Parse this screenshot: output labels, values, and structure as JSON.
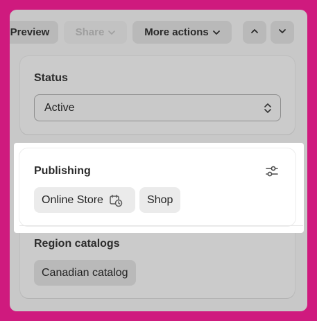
{
  "toolbar": {
    "preview_label": "Preview",
    "share_label": "Share",
    "more_actions_label": "More actions"
  },
  "status": {
    "title": "Status",
    "selected": "Active"
  },
  "publishing": {
    "title": "Publishing",
    "channels": [
      "Online Store",
      "Shop"
    ]
  },
  "region_catalogs": {
    "title": "Region catalogs",
    "items": [
      "Canadian catalog"
    ]
  },
  "colors": {
    "backdrop": "#cf1a7e",
    "highlight": "#ffffff",
    "overlay_gray": "#c8c8c8"
  },
  "icons": {
    "more_actions_caret": "chevron-down-icon",
    "prev": "chevron-up-icon",
    "next": "chevron-down-icon",
    "select_caret": "updown-icon",
    "manage": "sliders-icon",
    "schedule": "calendar-clock-icon"
  }
}
